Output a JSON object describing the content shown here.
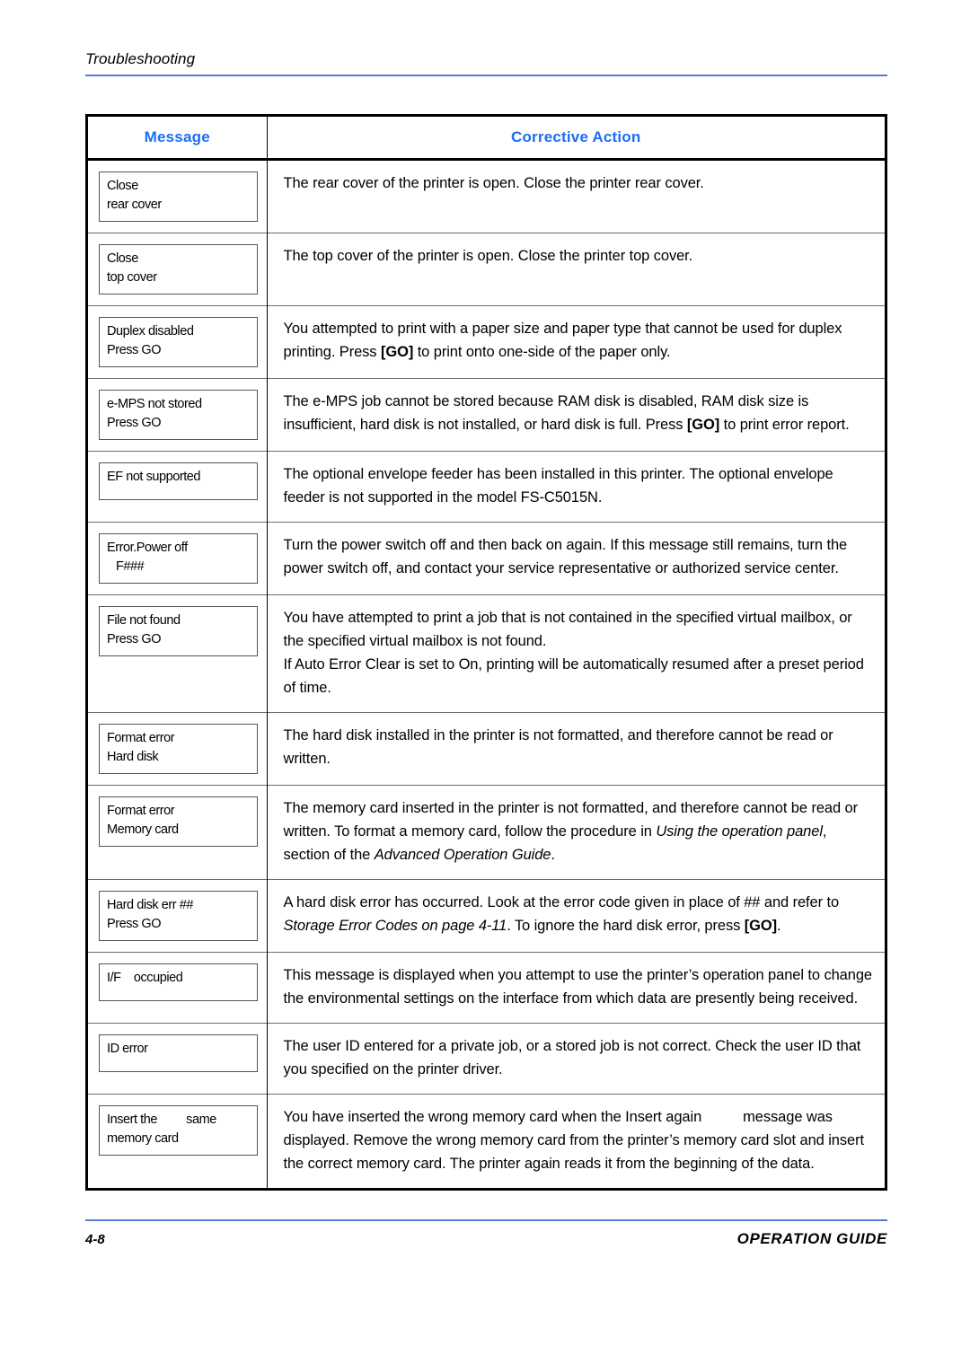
{
  "header": {
    "running_head": "Troubleshooting",
    "rule_color": "#5a78d8"
  },
  "table": {
    "accent_color": "#1b6ef5",
    "columns": [
      {
        "key": "message",
        "label": "Message"
      },
      {
        "key": "action",
        "label": "Corrective Action"
      }
    ],
    "rows": [
      {
        "message_lines": [
          "Close",
          "rear cover"
        ],
        "action_text": "The rear cover of the printer is open. Close the printer rear cover."
      },
      {
        "message_lines": [
          "Close",
          "top cover"
        ],
        "action_text": "The top cover of the printer is open. Close the printer top cover."
      },
      {
        "message_lines": [
          "Duplex disabled",
          "Press GO"
        ],
        "action_text": "You attempted to print with a paper size and paper type that cannot be used for duplex printing. Press [GO] to print onto one-side of the paper only.",
        "action_segment_a": "You attempted to print with a paper size and paper type that cannot be used for duplex printing. Press ",
        "action_segment_b": "[GO]",
        "action_segment_c": " to print onto one-side of the paper only."
      },
      {
        "message_lines": [
          "e-MPS not stored",
          "Press GO"
        ],
        "action_text": "The e-MPS job cannot be stored because RAM disk is disabled, RAM disk size is insufficient, hard disk is not installed, or hard disk is full. Press [GO] to print error report.",
        "action_segment_a": "The e-MPS job cannot be stored because RAM disk is disabled, RAM disk size is insufficient, hard disk is not installed, or hard disk is full. Press ",
        "action_segment_b": "[GO]",
        "action_segment_c": " to print error report."
      },
      {
        "message_lines": [
          "EF not supported"
        ],
        "action_text": "The optional envelope feeder has been installed in this printer. The optional envelope feeder is not supported in the model FS-C5015N."
      },
      {
        "message_lines": [
          "Error.Power off",
          "F###"
        ],
        "message_indent_line": 1,
        "action_text": "Turn the power switch off and then back on again. If this message still remains, turn the power switch off, and contact your service representative or authorized service center."
      },
      {
        "message_lines": [
          "File not found",
          "Press GO"
        ],
        "action_paragraphs": [
          "You have attempted to print a job that is not contained in the specified virtual mailbox, or the specified virtual mailbox is not found.",
          "If Auto Error Clear is set to On, printing will be automatically resumed after a preset period of time."
        ]
      },
      {
        "message_lines": [
          "Format error",
          "Hard disk"
        ],
        "action_text": "The hard disk installed in the printer is not formatted, and therefore cannot be read or written."
      },
      {
        "message_lines": [
          "Format error",
          "Memory card"
        ],
        "action_segment_a": "The memory card inserted in the printer is not formatted, and therefore cannot be read or written. To format a memory card, follow the procedure in ",
        "action_italic_a": "Using the operation panel",
        "action_segment_b": ", section of the ",
        "action_italic_b": "Advanced Operation Guide",
        "action_segment_c": "."
      },
      {
        "message_lines": [
          "Hard disk err ##",
          "Press GO"
        ],
        "action_segment_a": "A hard disk error has occurred. Look at the error code given in place of ## and refer to ",
        "action_italic_a": "Storage Error Codes on page 4-11",
        "action_segment_b": ". To ignore the hard disk error, press ",
        "action_bold_b": "[GO]",
        "action_segment_c": "."
      },
      {
        "message_lines": [
          "I/F    occupied"
        ],
        "action_text": "This message is displayed when you attempt to use the printer’s operation panel to change the environmental settings on the interface from which data are presently being received."
      },
      {
        "message_lines": [
          "ID error"
        ],
        "action_text": "The user ID entered for a private job, or a stored job is not correct. Check the user ID that you specified on the printer driver."
      },
      {
        "message_lines": [
          "Insert the         same",
          "memory card"
        ],
        "action_segment_a": "You have inserted the wrong memory card when the Insert again",
        "action_segment_gap": "",
        "action_segment_c": "message was displayed. Remove the wrong memory card from the printer’s memory card slot and insert the correct memory card. The printer again reads it from the beginning of the data."
      }
    ]
  },
  "footer": {
    "page_number": "4-8",
    "guide_label": "OPERATION GUIDE",
    "rule_color": "#5a78d8"
  }
}
